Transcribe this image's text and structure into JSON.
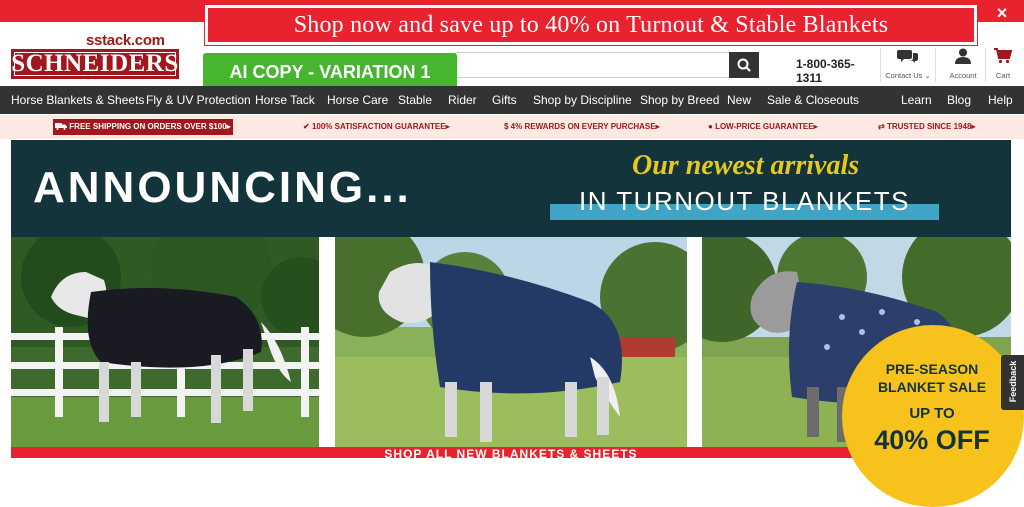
{
  "promo": {
    "text": "Shop now and save up to 40% on Turnout & Stable Blankets",
    "close": "×"
  },
  "header": {
    "site_url": "sstack.com",
    "logo": "SCHNEIDERS",
    "ai_badge": "AI COPY - VARIATION 1",
    "search_placeholder": "",
    "phone": "1-800-365-1311",
    "icons": [
      {
        "name": "contact-us",
        "label": "Contact Us ⌄",
        "icon": "chat-bubbles-icon"
      },
      {
        "name": "account",
        "label": "Account",
        "icon": "user-icon"
      },
      {
        "name": "cart",
        "label": "Cart",
        "icon": "cart-icon"
      }
    ]
  },
  "nav": {
    "items": [
      "Horse Blankets & Sheets",
      "Fly & UV Protection",
      "Horse Tack",
      "Horse Care",
      "Stable",
      "Rider",
      "Gifts",
      "Shop by Discipline",
      "Shop by Breed",
      "New",
      "Sale & Closeouts",
      "Learn",
      "Blog",
      "Help"
    ]
  },
  "value_props": {
    "shipping": "FREE SHIPPING ON ORDERS OVER $100▸",
    "satisfaction": "100% SATISFACTION GUARANTEE▸",
    "rewards": "4% REWARDS ON EVERY PURCHASE▸",
    "low_price": "LOW-PRICE GUARANTEE▸",
    "trusted": "TRUSTED SINCE 1948▸"
  },
  "hero": {
    "announce": "ANNOUNCING...",
    "script": "Our newest arrivals",
    "sub": "IN TURNOUT BLANKETS"
  },
  "sale": {
    "line1": "PRE-SEASON",
    "line2": "BLANKET SALE",
    "line3": "UP TO",
    "line4": "40% OFF"
  },
  "bottom_cta": "SHOP ALL NEW BLANKETS & SHEETS",
  "feedback": "Feedback",
  "colors": {
    "brand_red": "#a3161e",
    "promo_red": "#e8222e",
    "hero_teal": "#13343b",
    "accent_yellow": "#e5c91e",
    "accent_blue": "#3fa4c6",
    "sale_gold": "#f6c21b"
  }
}
